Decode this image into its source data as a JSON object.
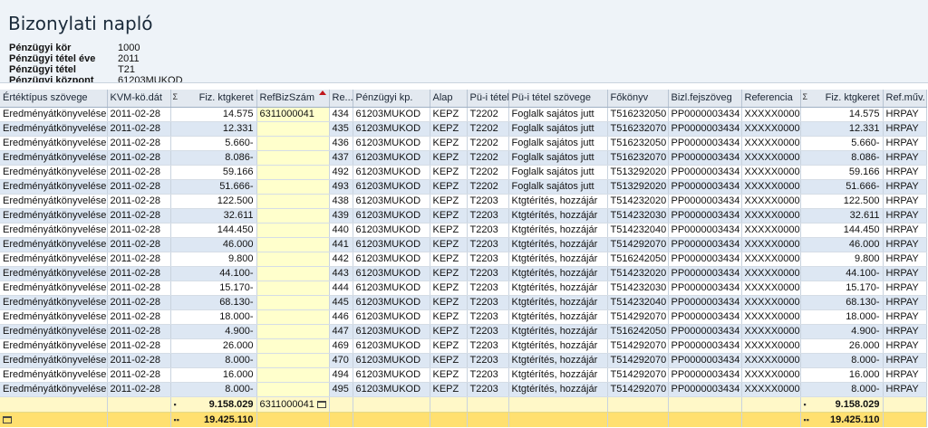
{
  "title": "Bizonylati napló",
  "meta": [
    {
      "label": "Pénzügyi kör",
      "value": "1000"
    },
    {
      "label": "Pénzügyi tétel éve",
      "value": "2011"
    },
    {
      "label": "Pénzügyi tétel",
      "value": "T21"
    },
    {
      "label": "Pénzügyi központ",
      "value": "61203MUKOD"
    }
  ],
  "columns": [
    {
      "label": "Értéktípus szövege"
    },
    {
      "label": "KVM-kö.dát"
    },
    {
      "label": "Fiz. ktgkeret",
      "sigma": "Σ"
    },
    {
      "label": "RefBizSzám"
    },
    {
      "label": "Re..."
    },
    {
      "label": "Pénzügyi kp."
    },
    {
      "label": "Alap"
    },
    {
      "label": "Pü-i tétel"
    },
    {
      "label": "Pü-i tétel szövege"
    },
    {
      "label": "Főkönyv"
    },
    {
      "label": "Bizl.fejszöveg"
    },
    {
      "label": "Referencia"
    },
    {
      "label": "Fiz. ktgkeret",
      "sigma": "Σ"
    },
    {
      "label": "Ref.műv."
    }
  ],
  "rows": [
    [
      "Eredményátkönyvelések",
      "2011-02-28",
      "14.575",
      "6311000041",
      "434",
      "61203MUKOD",
      "KEPZ",
      "T2202",
      "Foglalk sajátos jutt",
      "T516232050",
      "PP0000003434",
      "XXXXX00001",
      "14.575",
      "HRPAY"
    ],
    [
      "Eredményátkönyvelések",
      "2011-02-28",
      "12.331",
      "",
      "435",
      "61203MUKOD",
      "KEPZ",
      "T2202",
      "Foglalk sajátos jutt",
      "T516232070",
      "PP0000003434",
      "XXXXX00001",
      "12.331",
      "HRPAY"
    ],
    [
      "Eredményátkönyvelések",
      "2011-02-28",
      "5.660-",
      "",
      "436",
      "61203MUKOD",
      "KEPZ",
      "T2202",
      "Foglalk sajátos jutt",
      "T516232050",
      "PP0000003434",
      "XXXXX00001",
      "5.660-",
      "HRPAY"
    ],
    [
      "Eredményátkönyvelések",
      "2011-02-28",
      "8.086-",
      "",
      "437",
      "61203MUKOD",
      "KEPZ",
      "T2202",
      "Foglalk sajátos jutt",
      "T516232070",
      "PP0000003434",
      "XXXXX00001",
      "8.086-",
      "HRPAY"
    ],
    [
      "Eredményátkönyvelések",
      "2011-02-28",
      "59.166",
      "",
      "492",
      "61203MUKOD",
      "KEPZ",
      "T2202",
      "Foglalk sajátos jutt",
      "T513292020",
      "PP0000003434",
      "XXXXX00001",
      "59.166",
      "HRPAY"
    ],
    [
      "Eredményátkönyvelések",
      "2011-02-28",
      "51.666-",
      "",
      "493",
      "61203MUKOD",
      "KEPZ",
      "T2202",
      "Foglalk sajátos jutt",
      "T513292020",
      "PP0000003434",
      "XXXXX00001",
      "51.666-",
      "HRPAY"
    ],
    [
      "Eredményátkönyvelések",
      "2011-02-28",
      "122.500",
      "",
      "438",
      "61203MUKOD",
      "KEPZ",
      "T2203",
      "Ktgtérítés, hozzájár",
      "T514232020",
      "PP0000003434",
      "XXXXX00001",
      "122.500",
      "HRPAY"
    ],
    [
      "Eredményátkönyvelések",
      "2011-02-28",
      "32.611",
      "",
      "439",
      "61203MUKOD",
      "KEPZ",
      "T2203",
      "Ktgtérítés, hozzájár",
      "T514232030",
      "PP0000003434",
      "XXXXX00001",
      "32.611",
      "HRPAY"
    ],
    [
      "Eredményátkönyvelések",
      "2011-02-28",
      "144.450",
      "",
      "440",
      "61203MUKOD",
      "KEPZ",
      "T2203",
      "Ktgtérítés, hozzájár",
      "T514232040",
      "PP0000003434",
      "XXXXX00001",
      "144.450",
      "HRPAY"
    ],
    [
      "Eredményátkönyvelések",
      "2011-02-28",
      "46.000",
      "",
      "441",
      "61203MUKOD",
      "KEPZ",
      "T2203",
      "Ktgtérítés, hozzájár",
      "T514292070",
      "PP0000003434",
      "XXXXX00001",
      "46.000",
      "HRPAY"
    ],
    [
      "Eredményátkönyvelések",
      "2011-02-28",
      "9.800",
      "",
      "442",
      "61203MUKOD",
      "KEPZ",
      "T2203",
      "Ktgtérítés, hozzájár",
      "T516242050",
      "PP0000003434",
      "XXXXX00001",
      "9.800",
      "HRPAY"
    ],
    [
      "Eredményátkönyvelések",
      "2011-02-28",
      "44.100-",
      "",
      "443",
      "61203MUKOD",
      "KEPZ",
      "T2203",
      "Ktgtérítés, hozzájár",
      "T514232020",
      "PP0000003434",
      "XXXXX00001",
      "44.100-",
      "HRPAY"
    ],
    [
      "Eredményátkönyvelések",
      "2011-02-28",
      "15.170-",
      "",
      "444",
      "61203MUKOD",
      "KEPZ",
      "T2203",
      "Ktgtérítés, hozzájár",
      "T514232030",
      "PP0000003434",
      "XXXXX00001",
      "15.170-",
      "HRPAY"
    ],
    [
      "Eredményátkönyvelések",
      "2011-02-28",
      "68.130-",
      "",
      "445",
      "61203MUKOD",
      "KEPZ",
      "T2203",
      "Ktgtérítés, hozzájár",
      "T514232040",
      "PP0000003434",
      "XXXXX00001",
      "68.130-",
      "HRPAY"
    ],
    [
      "Eredményátkönyvelések",
      "2011-02-28",
      "18.000-",
      "",
      "446",
      "61203MUKOD",
      "KEPZ",
      "T2203",
      "Ktgtérítés, hozzájár",
      "T514292070",
      "PP0000003434",
      "XXXXX00001",
      "18.000-",
      "HRPAY"
    ],
    [
      "Eredményátkönyvelések",
      "2011-02-28",
      "4.900-",
      "",
      "447",
      "61203MUKOD",
      "KEPZ",
      "T2203",
      "Ktgtérítés, hozzájár",
      "T516242050",
      "PP0000003434",
      "XXXXX00001",
      "4.900-",
      "HRPAY"
    ],
    [
      "Eredményátkönyvelések",
      "2011-02-28",
      "26.000",
      "",
      "469",
      "61203MUKOD",
      "KEPZ",
      "T2203",
      "Ktgtérítés, hozzájár",
      "T514292070",
      "PP0000003434",
      "XXXXX00001",
      "26.000",
      "HRPAY"
    ],
    [
      "Eredményátkönyvelések",
      "2011-02-28",
      "8.000-",
      "",
      "470",
      "61203MUKOD",
      "KEPZ",
      "T2203",
      "Ktgtérítés, hozzájár",
      "T514292070",
      "PP0000003434",
      "XXXXX00001",
      "8.000-",
      "HRPAY"
    ],
    [
      "Eredményátkönyvelések",
      "2011-02-28",
      "16.000",
      "",
      "494",
      "61203MUKOD",
      "KEPZ",
      "T2203",
      "Ktgtérítés, hozzájár",
      "T514292070",
      "PP0000003434",
      "XXXXX00001",
      "16.000",
      "HRPAY"
    ],
    [
      "Eredményátkönyvelések",
      "2011-02-28",
      "8.000-",
      "",
      "495",
      "61203MUKOD",
      "KEPZ",
      "T2203",
      "Ktgtérítés, hozzájár",
      "T514292070",
      "PP0000003434",
      "XXXXX00001",
      "8.000-",
      "HRPAY"
    ]
  ],
  "subtotal": {
    "amount": "9.158.029",
    "ref": "6311000041",
    "amount2": "9.158.029"
  },
  "grand_total": {
    "amount": "19.425.110",
    "amount2": "19.425.110"
  },
  "colors": {
    "header_bg": "#eef3f8",
    "row_alt": "#dde7f3",
    "ref_col": "#ffffcc",
    "subtotal": "#fff8c8",
    "grand_total": "#ffe070"
  }
}
